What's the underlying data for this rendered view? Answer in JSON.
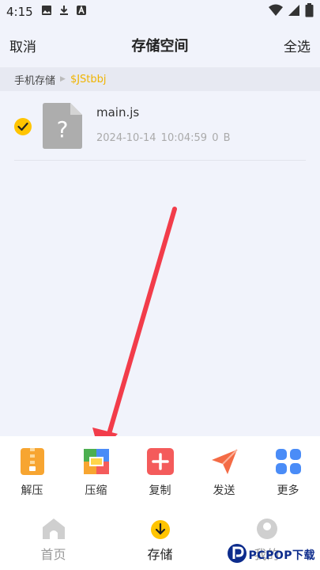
{
  "statusbar": {
    "time": "4:15"
  },
  "header": {
    "cancel_label": "取消",
    "title": "存储空间",
    "select_all_label": "全选"
  },
  "breadcrumb": {
    "root": "手机存储",
    "current": "$JStbbj"
  },
  "files": [
    {
      "name": "main.js",
      "date": "2024-10-14 10:04:59",
      "size": "0 B",
      "checked": true
    }
  ],
  "actions": [
    {
      "label": "解压",
      "icon": "unzip-icon",
      "color": "#f7a531"
    },
    {
      "label": "压缩",
      "icon": "compress-icon",
      "color": "#4caf50"
    },
    {
      "label": "复制",
      "icon": "copy-icon",
      "color": "#f45b5b"
    },
    {
      "label": "发送",
      "icon": "send-icon",
      "color": "#f46b45"
    },
    {
      "label": "更多",
      "icon": "more-icon",
      "color": "#4a8cf7"
    }
  ],
  "tabs": [
    {
      "label": "首页",
      "icon": "home-icon",
      "active": false
    },
    {
      "label": "存储",
      "icon": "storage-icon",
      "active": true
    },
    {
      "label": "我的",
      "icon": "profile-icon",
      "active": false
    }
  ],
  "watermark": {
    "text": "PCPOP下载"
  },
  "colors": {
    "accent": "#ffc400",
    "arrow": "#f23c4a",
    "breadcrumb_current": "#f0b400"
  }
}
